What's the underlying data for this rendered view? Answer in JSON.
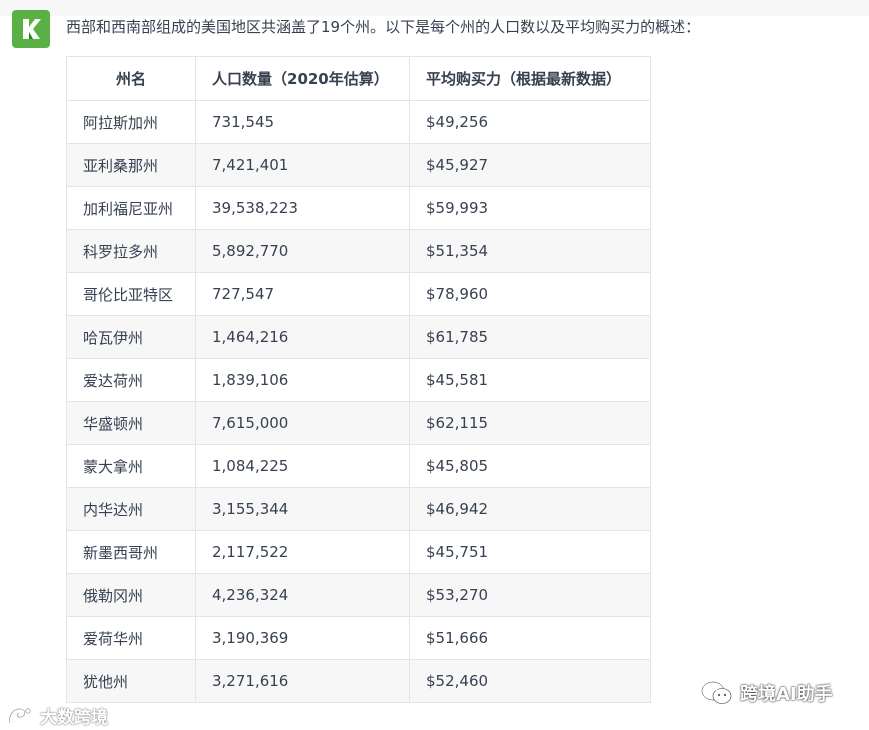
{
  "intro_text": "西部和西南部组成的美国地区共涵盖了19个州。以下是每个州的人口数以及平均购买力的概述：",
  "avatar": {
    "icon": "k-logo-icon",
    "letter": "K",
    "color": "#5ab044"
  },
  "table": {
    "headers": [
      "州名",
      "人口数量（2020年估算）",
      "平均购买力（根据最新数据）"
    ],
    "rows": [
      [
        "阿拉斯加州",
        "731,545",
        "$49,256"
      ],
      [
        "亚利桑那州",
        "7,421,401",
        "$45,927"
      ],
      [
        "加利福尼亚州",
        "39,538,223",
        "$59,993"
      ],
      [
        "科罗拉多州",
        "5,892,770",
        "$51,354"
      ],
      [
        "哥伦比亚特区",
        "727,547",
        "$78,960"
      ],
      [
        "哈瓦伊州",
        "1,464,216",
        "$61,785"
      ],
      [
        "爱达荷州",
        "1,839,106",
        "$45,581"
      ],
      [
        "华盛顿州",
        "7,615,000",
        "$62,115"
      ],
      [
        "蒙大拿州",
        "1,084,225",
        "$45,805"
      ],
      [
        "内华达州",
        "3,155,344",
        "$46,942"
      ],
      [
        "新墨西哥州",
        "2,117,522",
        "$45,751"
      ],
      [
        "俄勒冈州",
        "4,236,324",
        "$53,270"
      ],
      [
        "爱荷华州",
        "3,190,369",
        "$51,666"
      ],
      [
        "犹他州",
        "3,271,616",
        "$52,460"
      ]
    ]
  },
  "watermarks": {
    "left": "大数跨境",
    "right": "跨境AI助手"
  }
}
